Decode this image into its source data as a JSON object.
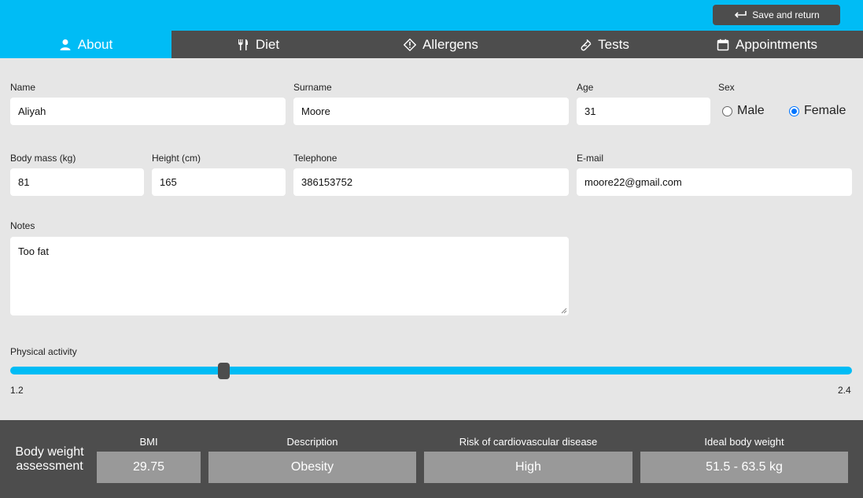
{
  "header": {
    "save_label": "Save and return"
  },
  "tabs": [
    {
      "label": "About",
      "icon": "person-icon",
      "active": true
    },
    {
      "label": "Diet",
      "icon": "fork-knife-icon"
    },
    {
      "label": "Allergens",
      "icon": "warning-diamond-icon"
    },
    {
      "label": "Tests",
      "icon": "test-tube-icon"
    },
    {
      "label": "Appointments",
      "icon": "calendar-icon"
    }
  ],
  "form": {
    "name": {
      "label": "Name",
      "value": "Aliyah"
    },
    "surname": {
      "label": "Surname",
      "value": "Moore"
    },
    "age": {
      "label": "Age",
      "value": "31"
    },
    "sex": {
      "label": "Sex",
      "options": [
        "Male",
        "Female"
      ],
      "selected": "Female"
    },
    "body_mass": {
      "label": "Body mass (kg)",
      "value": "81"
    },
    "height": {
      "label": "Height (cm)",
      "value": "165"
    },
    "telephone": {
      "label": "Telephone",
      "value": "386153752"
    },
    "email": {
      "label": "E-mail",
      "value": "moore22@gmail.com"
    },
    "notes": {
      "label": "Notes",
      "value": "Too fat"
    },
    "activity": {
      "label": "Physical activity",
      "min": "1.2",
      "max": "2.4",
      "value": 1.5
    }
  },
  "assessment": {
    "title": "Body weight assessment",
    "bmi": {
      "label": "BMI",
      "value": "29.75"
    },
    "description": {
      "label": "Description",
      "value": "Obesity"
    },
    "risk": {
      "label": "Risk of cardiovascular disease",
      "value": "High"
    },
    "ideal": {
      "label": "Ideal body weight",
      "value": "51.5 - 63.5 kg"
    }
  },
  "colors": {
    "accent": "#00bcf5",
    "dark": "#4d4d4d",
    "background": "#e6e6e6",
    "box": "#999999",
    "radio": "#0075ff"
  }
}
